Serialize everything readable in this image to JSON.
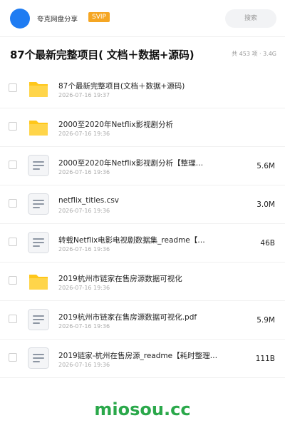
{
  "header": {
    "share_title": "夸克网盘分享",
    "badge": "SVIP",
    "search_label": "搜索"
  },
  "folder": {
    "title": "87个最新完整项目( 文档＋数据+源码)",
    "meta": "共 453 项 · 3.4G"
  },
  "files": [
    {
      "type": "folder",
      "name": "87个最新完整项目(文档＋数据+源码)",
      "date": "2026-07-16 19:37",
      "size": ""
    },
    {
      "type": "folder",
      "name": "2000至2020年Netflix影视剧分析",
      "date": "2026-07-16 19:36",
      "size": ""
    },
    {
      "type": "doc",
      "name": "2000至2020年Netflix影视剧分析【整理…",
      "date": "2026-07-16 19:36",
      "size": "5.6M"
    },
    {
      "type": "doc",
      "name": "netflix_titles.csv",
      "date": "2026-07-16 19:36",
      "size": "3.0M"
    },
    {
      "type": "doc",
      "name": "转载Netflix电影电视剧数据集_readme【…",
      "date": "2026-07-16 19:36",
      "size": "46B"
    },
    {
      "type": "folder",
      "name": "2019杭州市链家在售房源数据可视化",
      "date": "2026-07-16 19:36",
      "size": ""
    },
    {
      "type": "doc",
      "name": "2019杭州市链家在售房源数据可视化.pdf",
      "date": "2026-07-16 19:36",
      "size": "5.9M"
    },
    {
      "type": "doc",
      "name": "2019链家-杭州在售房源_readme【耗时整理…",
      "date": "2026-07-16 19:36",
      "size": "111B"
    }
  ],
  "watermark": "miosou.cc",
  "colors": {
    "accent": "#1f7cf2",
    "folder": "#ffc71a",
    "badge": "#f5a623",
    "watermark": "#2aa84a"
  }
}
